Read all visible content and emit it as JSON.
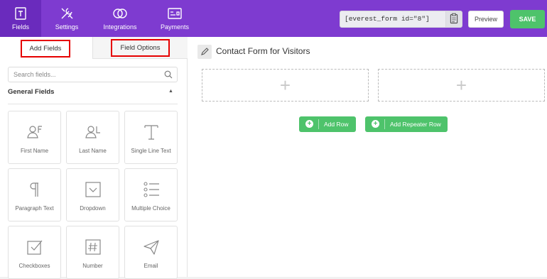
{
  "colors": {
    "brand": "#7e3bd0",
    "active_nav": "#6a2bbd",
    "success": "#4ec36b",
    "highlight_border": "#e60000"
  },
  "nav": {
    "fields": {
      "label": "Fields",
      "icon": "fields-icon"
    },
    "settings": {
      "label": "Settings",
      "icon": "settings-tools-icon"
    },
    "integrations": {
      "label": "Integrations",
      "icon": "integrations-rings-icon"
    },
    "payments": {
      "label": "Payments",
      "icon": "payments-card-icon"
    }
  },
  "toolbar": {
    "shortcode": "[everest_form id=\"8\"]",
    "preview_label": "Preview",
    "save_label": "SAVE"
  },
  "sidebar": {
    "tabs": {
      "add_fields": "Add Fields",
      "field_options": "Field Options"
    },
    "search_placeholder": "Search fields...",
    "section_title": "General Fields",
    "fields": [
      {
        "label": "First Name",
        "icon": "person-first-icon"
      },
      {
        "label": "Last Name",
        "icon": "person-last-icon"
      },
      {
        "label": "Single Line Text",
        "icon": "text-t-icon"
      },
      {
        "label": "Paragraph Text",
        "icon": "pilcrow-icon"
      },
      {
        "label": "Dropdown",
        "icon": "dropdown-icon"
      },
      {
        "label": "Multiple Choice",
        "icon": "list-radio-icon"
      },
      {
        "label": "Checkboxes",
        "icon": "checkbox-icon"
      },
      {
        "label": "Number",
        "icon": "hash-icon"
      },
      {
        "label": "Email",
        "icon": "paper-plane-icon"
      }
    ]
  },
  "main": {
    "form_title": "Contact Form for Visitors",
    "add_row_label": "Add Row",
    "add_repeater_row_label": "Add Repeater Row"
  }
}
